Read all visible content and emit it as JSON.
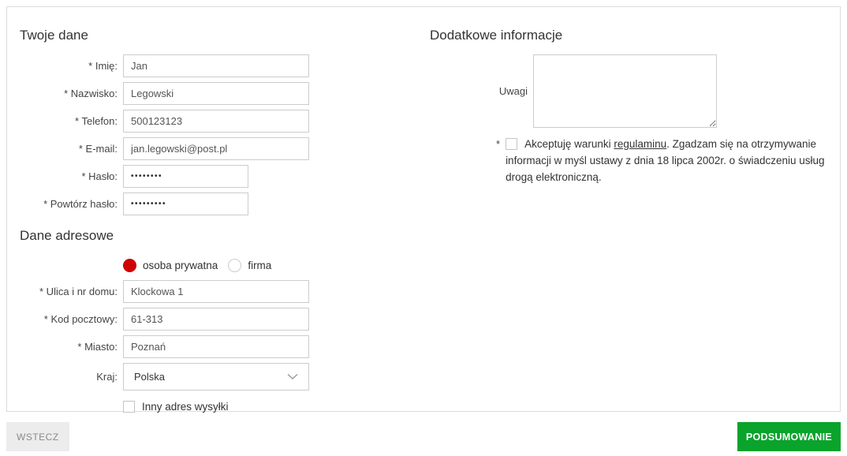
{
  "your_data": {
    "title": "Twoje dane",
    "fields": {
      "imie": {
        "label": "* Imię:",
        "value": "Jan"
      },
      "nazwisko": {
        "label": "* Nazwisko:",
        "value": "Legowski"
      },
      "telefon": {
        "label": "* Telefon:",
        "value": "500123123"
      },
      "email": {
        "label": "* E-mail:",
        "value": "jan.legowski@post.pl"
      },
      "haslo": {
        "label": "* Hasło:",
        "value": "••••••••"
      },
      "powtorz_haslo": {
        "label": "* Powtórz hasło:",
        "value": "•••••••••"
      }
    }
  },
  "address": {
    "title": "Dane adresowe",
    "account_type": {
      "options": [
        {
          "label": "osoba prywatna",
          "selected": true
        },
        {
          "label": "firma",
          "selected": false
        }
      ]
    },
    "fields": {
      "ulica": {
        "label": "* Ulica i nr domu:",
        "value": "Klockowa 1"
      },
      "kod_pocztowy": {
        "label": "* Kod pocztowy:",
        "value": "61-313"
      },
      "miasto": {
        "label": "* Miasto:",
        "value": "Poznań"
      },
      "kraj": {
        "label": "Kraj:",
        "value": "Polska"
      }
    },
    "other_shipping": {
      "label": "Inny adres wysyłki",
      "checked": false
    }
  },
  "additional": {
    "title": "Dodatkowe informacje",
    "uwagi": {
      "label": "Uwagi",
      "value": ""
    },
    "terms": {
      "asterisk": "*",
      "checked": false,
      "text_before_link": "Akceptuję warunki ",
      "link": "regulaminu",
      "text_after_link": ". Zgadzam się na otrzymywanie informacji w myśl ustawy z dnia 18 lipca 2002r. o świadczeniu usług drogą elektroniczną."
    }
  },
  "footer": {
    "back_label": "WSTECZ",
    "submit_label": "PODSUMOWANIE"
  },
  "colors": {
    "accent_green": "#0aa32c",
    "radio_selected_red": "#d10000",
    "input_border": "#cccccc",
    "panel_border": "#dcdcdc"
  }
}
